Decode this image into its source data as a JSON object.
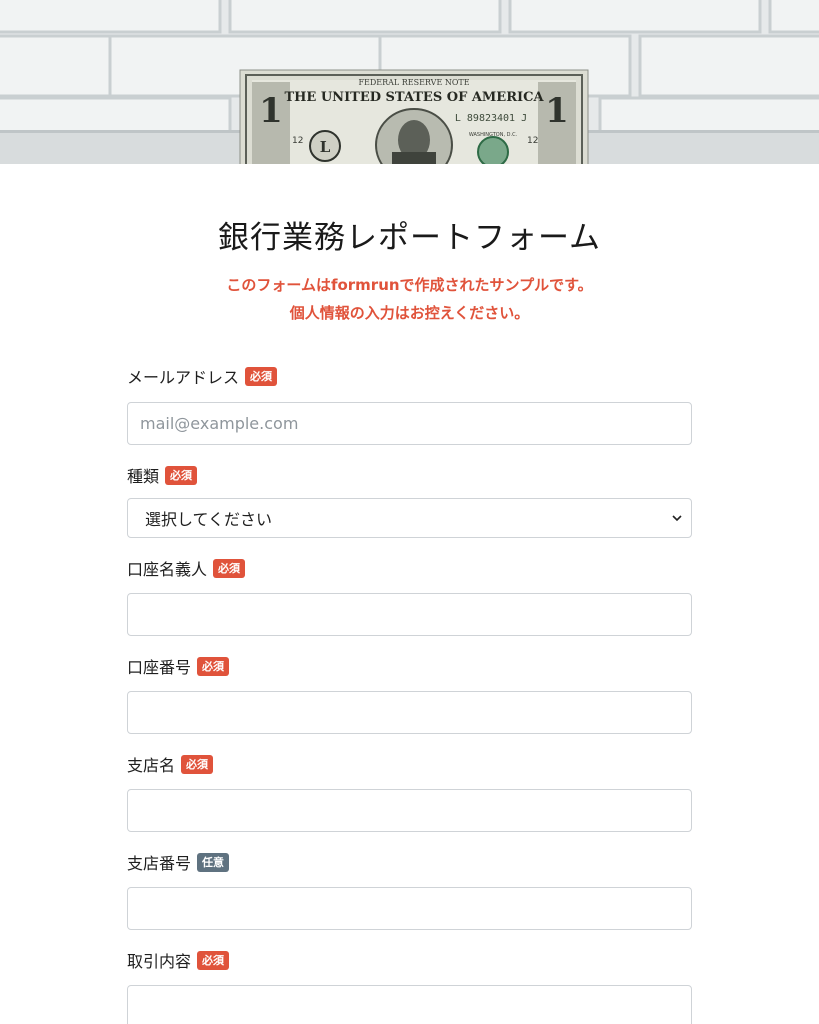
{
  "hero": {
    "alt_image": "dollar-bill-on-brick-wall",
    "bill_text": {
      "top_line": "FEDERAL RESERVE NOTE",
      "country": "THE UNITED STATES OF AMERICA",
      "serial": "L 89823401 J",
      "denomination": "1",
      "seal_letter": "L",
      "district_number": "12",
      "place": "WASHINGTON, D.C."
    }
  },
  "form": {
    "title": "銀行業務レポートフォーム",
    "notice_line1": "このフォームはformrunで作成されたサンプルです。",
    "notice_line2": "個人情報の入力はお控えください。",
    "fields": [
      {
        "label": "メールアドレス",
        "badge": "必須",
        "placeholder": "mail@example.com"
      },
      {
        "label": "種類",
        "badge": "必須",
        "selected": "選択してください"
      },
      {
        "label": "口座名義人",
        "badge": "必須"
      },
      {
        "label": "口座番号",
        "badge": "必須"
      },
      {
        "label": "支店名",
        "badge": "必須"
      },
      {
        "label": "支店番号",
        "badge": "任意"
      },
      {
        "label": "取引内容",
        "badge": "必須"
      }
    ]
  },
  "colors": {
    "required_badge": "#e0533b",
    "optional_badge": "#5f7280",
    "notice_text": "#e0533b"
  }
}
